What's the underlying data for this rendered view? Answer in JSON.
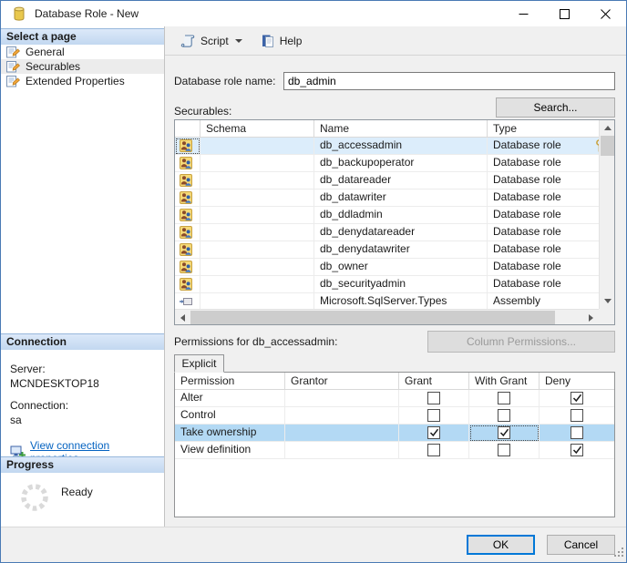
{
  "window": {
    "title": "Database Role - New"
  },
  "sidebar": {
    "select_page_header": "Select a page",
    "pages": [
      {
        "label": "General",
        "selected": false
      },
      {
        "label": "Securables",
        "selected": true
      },
      {
        "label": "Extended Properties",
        "selected": false
      }
    ],
    "connection_header": "Connection",
    "server_label": "Server:",
    "server_value": "MCNDESKTOP18",
    "connection_label": "Connection:",
    "connection_value": "sa",
    "view_connection_link": "View connection properties",
    "progress_header": "Progress",
    "progress_status": "Ready"
  },
  "toolbar": {
    "script_label": "Script",
    "help_label": "Help"
  },
  "main": {
    "role_name_label": "Database role name:",
    "role_name_value": "db_admin",
    "securables_label": "Securables:",
    "search_button": "Search...",
    "securables_table": {
      "columns": [
        "Schema",
        "Name",
        "Type"
      ],
      "rows": [
        {
          "schema": "",
          "name": "db_accessadmin",
          "type": "Database role",
          "icon": "role",
          "selected": true
        },
        {
          "schema": "",
          "name": "db_backupoperator",
          "type": "Database role",
          "icon": "role",
          "selected": false
        },
        {
          "schema": "",
          "name": "db_datareader",
          "type": "Database role",
          "icon": "role",
          "selected": false
        },
        {
          "schema": "",
          "name": "db_datawriter",
          "type": "Database role",
          "icon": "role",
          "selected": false
        },
        {
          "schema": "",
          "name": "db_ddladmin",
          "type": "Database role",
          "icon": "role",
          "selected": false
        },
        {
          "schema": "",
          "name": "db_denydatareader",
          "type": "Database role",
          "icon": "role",
          "selected": false
        },
        {
          "schema": "",
          "name": "db_denydatawriter",
          "type": "Database role",
          "icon": "role",
          "selected": false
        },
        {
          "schema": "",
          "name": "db_owner",
          "type": "Database role",
          "icon": "role",
          "selected": false
        },
        {
          "schema": "",
          "name": "db_securityadmin",
          "type": "Database role",
          "icon": "role",
          "selected": false
        },
        {
          "schema": "",
          "name": "Microsoft.SqlServer.Types",
          "type": "Assembly",
          "icon": "assembly",
          "selected": false
        }
      ]
    },
    "permissions_label": "Permissions for db_accessadmin:",
    "column_permissions_button": "Column Permissions...",
    "explicit_tab": "Explicit",
    "permissions_table": {
      "columns": [
        "Permission",
        "Grantor",
        "Grant",
        "With Grant",
        "Deny"
      ],
      "rows": [
        {
          "permission": "Alter",
          "grantor": "",
          "grant": false,
          "with_grant": false,
          "deny": true,
          "selected": false,
          "focused_cell": null
        },
        {
          "permission": "Control",
          "grantor": "",
          "grant": false,
          "with_grant": false,
          "deny": false,
          "selected": false,
          "focused_cell": null
        },
        {
          "permission": "Take ownership",
          "grantor": "",
          "grant": true,
          "with_grant": true,
          "deny": false,
          "selected": true,
          "focused_cell": "with_grant"
        },
        {
          "permission": "View definition",
          "grantor": "",
          "grant": false,
          "with_grant": false,
          "deny": true,
          "selected": false,
          "focused_cell": null
        }
      ]
    }
  },
  "footer": {
    "ok_button": "OK",
    "cancel_button": "Cancel"
  },
  "colors": {
    "window_border": "#4a7ab5",
    "accent_blue": "#0078d7",
    "row_selection_light": "#dcedfb",
    "row_selection_strong": "#b3d9f4",
    "panel_header_top": "#dce9f9",
    "panel_header_bottom": "#c2d8f0",
    "link_blue": "#0563c1"
  }
}
